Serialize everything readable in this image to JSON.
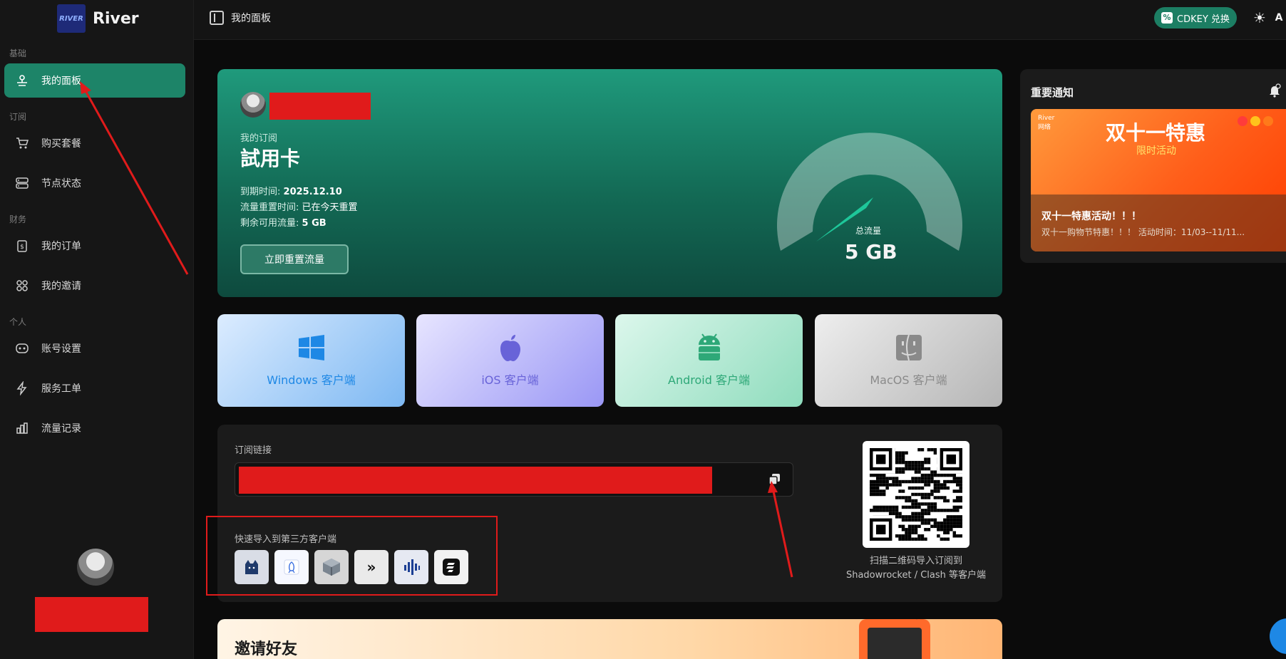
{
  "brand": {
    "logo_text": "RIVER",
    "name": "River"
  },
  "sidebar": {
    "groups": [
      {
        "label": "基础"
      },
      {
        "label": "订阅"
      },
      {
        "label": "财务"
      },
      {
        "label": "个人"
      }
    ],
    "items": [
      {
        "label": "我的面板",
        "icon": "dashboard-icon",
        "active": true
      },
      {
        "label": "购买套餐",
        "icon": "cart-icon"
      },
      {
        "label": "节点状态",
        "icon": "server-icon"
      },
      {
        "label": "我的订单",
        "icon": "order-icon"
      },
      {
        "label": "我的邀请",
        "icon": "invite-icon"
      },
      {
        "label": "账号设置",
        "icon": "account-icon"
      },
      {
        "label": "服务工单",
        "icon": "bolt-icon"
      },
      {
        "label": "流量记录",
        "icon": "chart-icon"
      }
    ]
  },
  "topbar": {
    "title": "我的面板",
    "cdkey_label": "CDKEY 兑换",
    "lang_label": "A"
  },
  "subscription": {
    "label": "我的订阅",
    "plan": "試用卡",
    "expire_label": "到期时间:",
    "expire_value": "2025.12.10",
    "reset_label": "流量重置时间:",
    "reset_value": "已在今天重置",
    "remain_label": "剩余可用流量:",
    "remain_value": "5 GB",
    "reset_button": "立即重置流量",
    "gauge_label": "总流量",
    "gauge_value": "5 GB",
    "gauge_fraction": 0.15
  },
  "clients": [
    {
      "label": "Windows 客户端",
      "icon": "windows-icon"
    },
    {
      "label": "iOS 客户端",
      "icon": "apple-icon"
    },
    {
      "label": "Android 客户端",
      "icon": "android-icon"
    },
    {
      "label": "MacOS 客户端",
      "icon": "finder-icon"
    }
  ],
  "link_panel": {
    "label": "订阅链接",
    "quick_label": "快速导入到第三方客户端",
    "qr_caption_line1": "扫描二维码导入订阅到",
    "qr_caption_line2": "Shadowrocket / Clash 等客户端",
    "quick_clients": [
      {
        "icon": "clash-cat-icon"
      },
      {
        "icon": "shadowrocket-icon"
      },
      {
        "icon": "box-icon"
      },
      {
        "icon": "double-chevron-icon"
      },
      {
        "icon": "stash-bars-icon"
      },
      {
        "icon": "surge-icon"
      }
    ]
  },
  "invite": {
    "title": "邀请好友"
  },
  "notice": {
    "title": "重要通知",
    "banner_brand": "River",
    "banner_brand_sub": "网络",
    "banner_main": "双十一特惠",
    "banner_sub": "限时活动",
    "headline": "双十一特惠活动！！！",
    "text": "双十一购物节特惠！！！ 活动时间：11/03--11/11..."
  },
  "colors": {
    "accent": "#1d8468",
    "annotation": "#e01b1b"
  }
}
